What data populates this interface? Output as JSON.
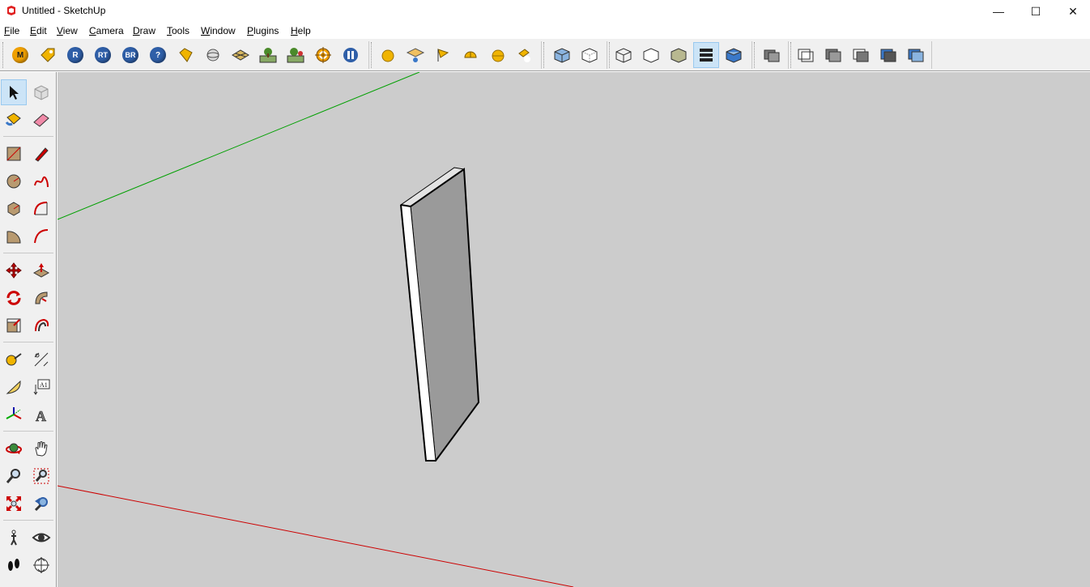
{
  "window": {
    "title": "Untitled - SketchUp",
    "minimize_glyph": "—",
    "maximize_glyph": "☐",
    "close_glyph": "✕"
  },
  "menu": [
    {
      "label": "File",
      "mnemonic": "F",
      "rest": "ile"
    },
    {
      "label": "Edit",
      "mnemonic": "E",
      "rest": "dit"
    },
    {
      "label": "View",
      "mnemonic": "V",
      "rest": "iew"
    },
    {
      "label": "Camera",
      "mnemonic": "C",
      "rest": "amera"
    },
    {
      "label": "Draw",
      "mnemonic": "D",
      "rest": "raw"
    },
    {
      "label": "Tools",
      "mnemonic": "T",
      "rest": "ools"
    },
    {
      "label": "Window",
      "mnemonic": "W",
      "rest": "indow"
    },
    {
      "label": "Plugins",
      "mnemonic": "P",
      "rest": "lugins"
    },
    {
      "label": "Help",
      "mnemonic": "H",
      "rest": "elp"
    }
  ],
  "toolbar": {
    "ruby_buttons": [
      {
        "name": "m-button",
        "text": "M",
        "color": "#f0a000"
      },
      {
        "name": "tag-button",
        "text": "",
        "color": "#e8b000"
      },
      {
        "name": "r-button",
        "text": "R",
        "color": "#2f5fa8"
      },
      {
        "name": "rt-button",
        "text": "RT",
        "color": "#2f5fa8"
      },
      {
        "name": "br-button",
        "text": "BR",
        "color": "#2f5fa8"
      },
      {
        "name": "help-button",
        "text": "?",
        "color": "#2f5fa8"
      }
    ],
    "colors": {
      "accent_blue": "#3a78c8",
      "accent_yellow": "#f0b400",
      "active_bg": "#cce4f7"
    },
    "active_button": "monochrome-style-button"
  },
  "sidebar": {
    "active_tool": "select-tool"
  },
  "viewport": {
    "background": "#cccccc",
    "green_axis": "#00a000",
    "red_axis": "#cc0000",
    "panel_front": "#9a9a9a",
    "panel_side": "#ffffff",
    "panel_top": "#e4e4e4"
  }
}
